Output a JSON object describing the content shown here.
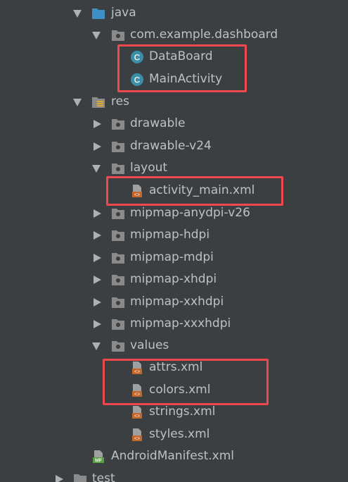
{
  "tree": {
    "java": {
      "label": "java",
      "icon": "folder-source-icon"
    },
    "package": {
      "label": "com.example.dashboard",
      "icon": "package-icon"
    },
    "databoard": {
      "label": "DataBoard",
      "icon": "class-icon",
      "icon_glyph": "C"
    },
    "mainactivity": {
      "label": "MainActivity",
      "icon": "class-icon",
      "icon_glyph": "C"
    },
    "res": {
      "label": "res",
      "icon": "folder-resources-icon"
    },
    "drawable": {
      "label": "drawable",
      "icon": "folder-icon"
    },
    "drawable_v24": {
      "label": "drawable-v24",
      "icon": "folder-icon"
    },
    "layout": {
      "label": "layout",
      "icon": "folder-icon"
    },
    "activity_main": {
      "label": "activity_main.xml",
      "icon": "xml-file-icon"
    },
    "mipmap_anydpi": {
      "label": "mipmap-anydpi-v26",
      "icon": "folder-icon"
    },
    "mipmap_hdpi": {
      "label": "mipmap-hdpi",
      "icon": "folder-icon"
    },
    "mipmap_mdpi": {
      "label": "mipmap-mdpi",
      "icon": "folder-icon"
    },
    "mipmap_xhdpi": {
      "label": "mipmap-xhdpi",
      "icon": "folder-icon"
    },
    "mipmap_xxhdpi": {
      "label": "mipmap-xxhdpi",
      "icon": "folder-icon"
    },
    "mipmap_xxxhdpi": {
      "label": "mipmap-xxxhdpi",
      "icon": "folder-icon"
    },
    "values": {
      "label": "values",
      "icon": "folder-icon"
    },
    "attrs": {
      "label": "attrs.xml",
      "icon": "xml-file-icon"
    },
    "colors": {
      "label": "colors.xml",
      "icon": "xml-file-icon"
    },
    "strings": {
      "label": "strings.xml",
      "icon": "xml-file-icon"
    },
    "styles": {
      "label": "styles.xml",
      "icon": "xml-file-icon"
    },
    "manifest": {
      "label": "AndroidManifest.xml",
      "icon": "manifest-icon",
      "icon_glyph": "MF"
    },
    "test": {
      "label": "test",
      "icon": "folder-icon"
    }
  },
  "colors": {
    "background": "#3c3f41",
    "text": "#c0c0c0",
    "highlight": "#f0484f",
    "folder_blue": "#3d8fc6",
    "class_teal": "#3a8ea8",
    "xml_orange": "#c5672a",
    "manifest_green": "#5a9e44"
  }
}
